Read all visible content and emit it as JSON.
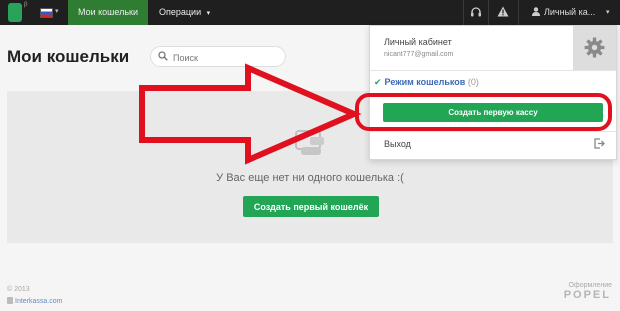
{
  "nav": {
    "logo_beta": "β",
    "tab_active": "Мои кошельки",
    "tab_operations": "Операции",
    "caret": "▾",
    "user_label": "Личный ка..."
  },
  "page": {
    "title": "Мои кошельки",
    "search_placeholder": "Поиск",
    "empty_text": "У Вас еще нет ни одного кошелька :(",
    "create_wallet_button": "Создать первый кошелёк"
  },
  "dropdown": {
    "title": "Личный кабинет",
    "email": "nicant777@gmail.com",
    "mode_label": "Режим кошельков",
    "mode_count": "(0)",
    "create_cashbox_button": "Создать первую кассу",
    "exit_label": "Выход"
  },
  "footer": {
    "copyright": "© 2013",
    "site": "Interkassa.com",
    "design_label": "Оформление",
    "design_brand": "POPEL"
  },
  "colors": {
    "accent_green": "#22a656",
    "nav_active": "#2e7d32",
    "annotation_red": "#e0101e"
  }
}
